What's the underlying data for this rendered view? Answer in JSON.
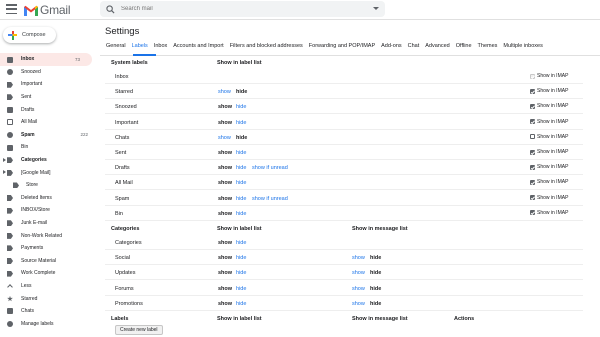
{
  "app": {
    "logo_text": "Gmail"
  },
  "search": {
    "placeholder": "Search mail"
  },
  "compose": {
    "label": "Compose"
  },
  "sidebar": {
    "items": [
      {
        "label": "Inbox",
        "count": "73",
        "icon": "inbox-icon"
      },
      {
        "label": "Snoozed",
        "count": "",
        "icon": "clock-icon"
      },
      {
        "label": "Important",
        "count": "",
        "icon": "label-important-icon"
      },
      {
        "label": "Sent",
        "count": "",
        "icon": "send-icon"
      },
      {
        "label": "Drafts",
        "count": "",
        "icon": "draft-icon"
      },
      {
        "label": "All Mail",
        "count": "",
        "icon": "mail-icon"
      },
      {
        "label": "Spam",
        "count": "222",
        "icon": "report-icon"
      },
      {
        "label": "Bin",
        "count": "",
        "icon": "trash-icon"
      },
      {
        "label": "Categories",
        "count": "",
        "icon": "label-icon"
      },
      {
        "label": "[Google Mail]",
        "count": "",
        "icon": "label-icon"
      },
      {
        "label": "Store",
        "count": "",
        "icon": "label-icon"
      },
      {
        "label": "Deleted Items",
        "count": "",
        "icon": "label-icon"
      },
      {
        "label": "INBOX/Store",
        "count": "",
        "icon": "label-icon"
      },
      {
        "label": "Junk E-mail",
        "count": "",
        "icon": "label-icon"
      },
      {
        "label": "Non-Work Related",
        "count": "",
        "icon": "label-icon"
      },
      {
        "label": "Payments",
        "count": "",
        "icon": "label-icon"
      },
      {
        "label": "Source Material",
        "count": "",
        "icon": "label-icon"
      },
      {
        "label": "Work Complete",
        "count": "",
        "icon": "label-icon"
      },
      {
        "label": "Less",
        "count": "",
        "icon": "chevron-up-icon"
      },
      {
        "label": "Starred",
        "count": "",
        "icon": "star-icon"
      },
      {
        "label": "Chats",
        "count": "",
        "icon": "chat-icon"
      },
      {
        "label": "Manage labels",
        "count": "",
        "icon": "gear-icon"
      }
    ]
  },
  "settings": {
    "title": "Settings",
    "tabs": [
      "General",
      "Labels",
      "Inbox",
      "Accounts and Import",
      "Filters and blocked addresses",
      "Forwarding and POP/IMAP",
      "Add-ons",
      "Chat",
      "Advanced",
      "Offline",
      "Themes",
      "Multiple inboxes"
    ],
    "system": {
      "heading": "System labels",
      "col_label_list": "Show in label list",
      "rows": [
        {
          "name": "Inbox",
          "show": "",
          "hide": "",
          "unread": "",
          "imap": "Show in IMAP"
        },
        {
          "name": "Starred",
          "show": "show",
          "hide": "hide",
          "unread": "",
          "imap": "Show in IMAP"
        },
        {
          "name": "Snoozed",
          "show": "show",
          "hide": "hide",
          "unread": "",
          "imap": "Show in IMAP"
        },
        {
          "name": "Important",
          "show": "show",
          "hide": "hide",
          "unread": "",
          "imap": "Show in IMAP"
        },
        {
          "name": "Chats",
          "show": "show",
          "hide": "hide",
          "unread": "",
          "imap": "Show in IMAP"
        },
        {
          "name": "Sent",
          "show": "show",
          "hide": "hide",
          "unread": "",
          "imap": "Show in IMAP"
        },
        {
          "name": "Drafts",
          "show": "show",
          "hide": "hide",
          "unread": "show if unread",
          "imap": "Show in IMAP"
        },
        {
          "name": "All Mail",
          "show": "show",
          "hide": "hide",
          "unread": "",
          "imap": "Show in IMAP"
        },
        {
          "name": "Spam",
          "show": "show",
          "hide": "hide",
          "unread": "show if unread",
          "imap": "Show in IMAP"
        },
        {
          "name": "Bin",
          "show": "show",
          "hide": "hide",
          "unread": "",
          "imap": "Show in IMAP"
        }
      ]
    },
    "categories": {
      "heading": "Categories",
      "col_label_list": "Show in label list",
      "col_message_list": "Show in message list",
      "rows": [
        {
          "name": "Categories",
          "show": "show",
          "hide": "hide",
          "m_show": "",
          "m_hide": ""
        },
        {
          "name": "Social",
          "show": "show",
          "hide": "hide",
          "m_show": "show",
          "m_hide": "hide"
        },
        {
          "name": "Updates",
          "show": "show",
          "hide": "hide",
          "m_show": "show",
          "m_hide": "hide"
        },
        {
          "name": "Forums",
          "show": "show",
          "hide": "hide",
          "m_show": "show",
          "m_hide": "hide"
        },
        {
          "name": "Promotions",
          "show": "show",
          "hide": "hide",
          "m_show": "show",
          "m_hide": "hide"
        }
      ]
    },
    "labels": {
      "heading": "Labels",
      "col_label_list": "Show in label list",
      "col_message_list": "Show in message list",
      "col_actions": "Actions",
      "create_button": "Create new label"
    }
  },
  "colors": {
    "accent": "#1a73e8",
    "active_bg": "#fce8e6"
  }
}
